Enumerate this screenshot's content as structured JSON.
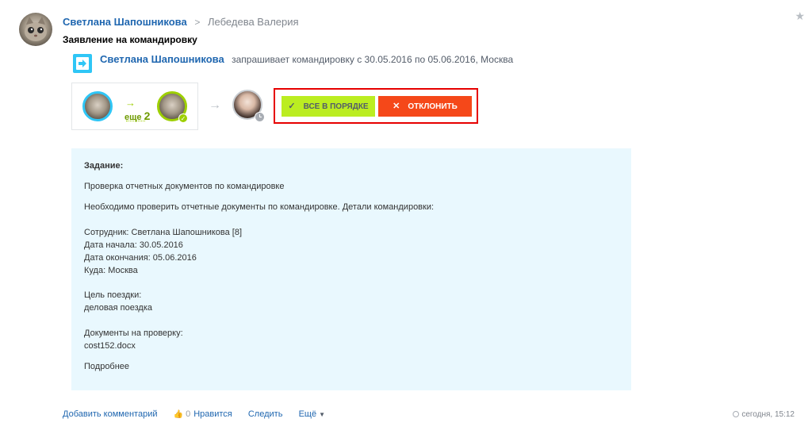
{
  "header": {
    "author": "Светлана Шапошникова",
    "chevron": ">",
    "recipient": "Лебедева Валерия",
    "title": "Заявление на командировку"
  },
  "process": {
    "author": "Светлана Шапошникова",
    "text": "запрашивает командировку с 30.05.2016 по 05.06.2016, Москва",
    "more_label": "еще",
    "more_count": "2",
    "arrow": "→"
  },
  "actions": {
    "approve_label": "Все в порядке",
    "approve_icon": "✓",
    "decline_label": "Отклонить",
    "decline_icon": "✕",
    "approve_color": "#bbed21",
    "decline_color": "#f54819"
  },
  "task": {
    "heading": "Задание:",
    "subject": "Проверка отчетных документов по командировке",
    "description": "Необходимо проверить отчетные документы по командировке. Детали командировки:",
    "employee": "Сотрудник: Светлана Шапошникова [8]",
    "start_date": "Дата начала: 30.05.2016",
    "end_date": "Дата окончания: 05.06.2016",
    "destination": "Куда: Москва",
    "purpose_label": "Цель поездки:",
    "purpose_value": "деловая поездка",
    "docs_label": "Документы на проверку:",
    "doc_file": "cost152.docx",
    "more_link": "Подробнее"
  },
  "footer": {
    "add_comment": "Добавить комментарий",
    "like_count": "0",
    "like_label": "Нравится",
    "follow": "Следить",
    "more": "Ещё",
    "timestamp": "сегодня, 15:12"
  },
  "icons": {
    "star": "star-icon",
    "process": "business-process-icon",
    "check": "check-icon",
    "clock": "clock-icon",
    "like": "thumbs-up-icon"
  }
}
